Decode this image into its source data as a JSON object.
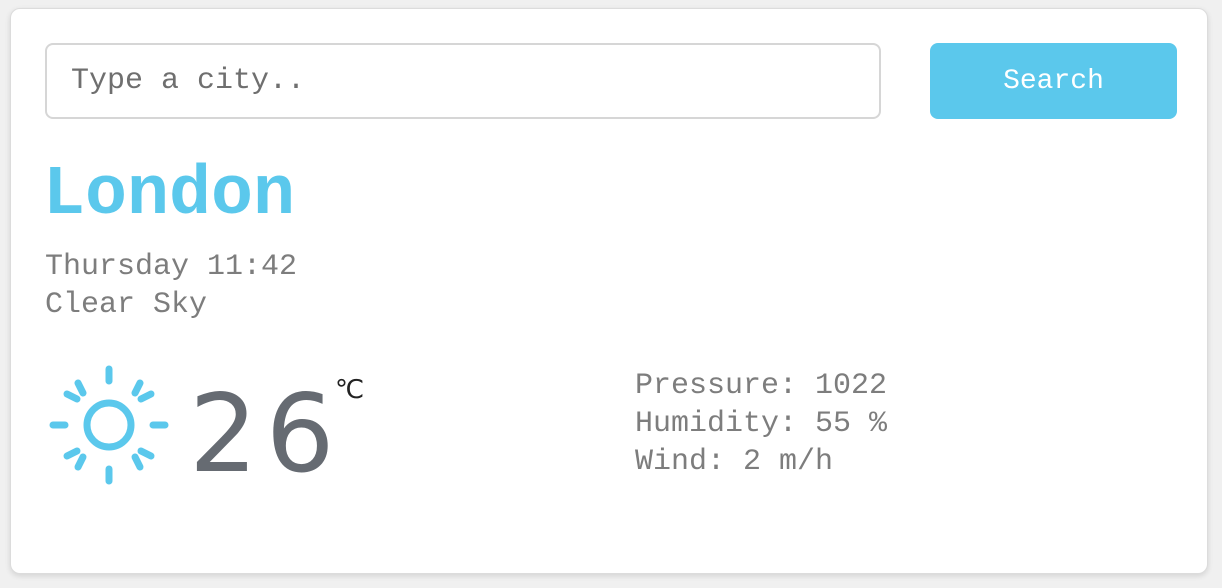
{
  "search": {
    "placeholder": "Type a city..",
    "value": "",
    "button_label": "Search"
  },
  "weather": {
    "city": "London",
    "datetime": "Thursday 11:42",
    "condition": "Clear Sky",
    "icon": "sun-icon",
    "temperature": "26",
    "unit": "℃",
    "pressure": "Pressure: 1022",
    "humidity": "Humidity: 55 %",
    "wind": "Wind: 2 m/h"
  },
  "colors": {
    "accent": "#5bc8ec",
    "text_muted": "#7d7d7d",
    "temp_text": "#666b72"
  }
}
